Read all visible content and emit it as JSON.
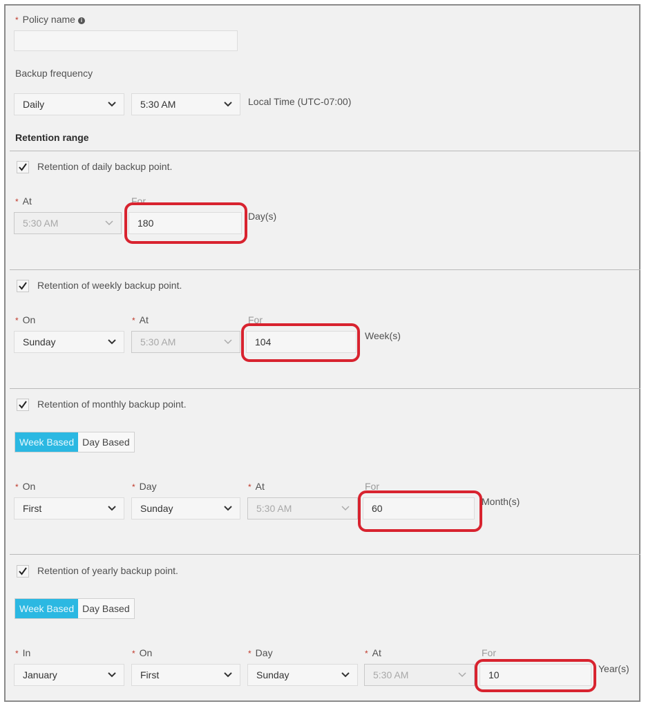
{
  "policy_name": {
    "label": "Policy name",
    "required": true,
    "value": "",
    "info_icon": "info-icon"
  },
  "backup_frequency": {
    "label": "Backup frequency",
    "frequency": "Daily",
    "time": "5:30 AM",
    "timezone_label": "Local Time (UTC-07:00)"
  },
  "retention_range": {
    "heading": "Retention range"
  },
  "daily": {
    "checkbox_label": "Retention of daily backup point.",
    "checked": true,
    "at_label": "At",
    "at_value": "5:30 AM",
    "for_label": "For",
    "for_value": "180",
    "unit": "Day(s)"
  },
  "weekly": {
    "checkbox_label": "Retention of weekly backup point.",
    "checked": true,
    "on_label": "On",
    "on_value": "Sunday",
    "at_label": "At",
    "at_value": "5:30 AM",
    "for_label": "For",
    "for_value": "104",
    "unit": "Week(s)"
  },
  "monthly": {
    "checkbox_label": "Retention of monthly backup point.",
    "checked": true,
    "toggle": {
      "options": [
        "Week Based",
        "Day Based"
      ],
      "selected": "Week Based"
    },
    "on_label": "On",
    "on_value": "First",
    "day_label": "Day",
    "day_value": "Sunday",
    "at_label": "At",
    "at_value": "5:30 AM",
    "for_label": "For",
    "for_value": "60",
    "unit": "Month(s)"
  },
  "yearly": {
    "checkbox_label": "Retention of yearly backup point.",
    "checked": true,
    "toggle": {
      "options": [
        "Week Based",
        "Day Based"
      ],
      "selected": "Week Based"
    },
    "in_label": "In",
    "in_value": "January",
    "on_label": "On",
    "on_value": "First",
    "day_label": "Day",
    "day_value": "Sunday",
    "at_label": "At",
    "at_value": "5:30 AM",
    "for_label": "For",
    "for_value": "10",
    "unit": "Year(s)"
  },
  "colors": {
    "accent": "#2bb8e2",
    "highlight": "#d8232f",
    "required": "#c0392b"
  },
  "required_marker": "*"
}
